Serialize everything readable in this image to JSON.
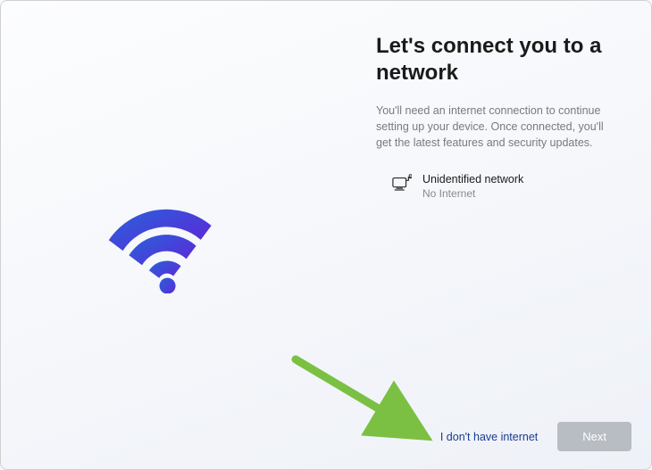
{
  "title": "Let's connect you to a network",
  "subtitle": "You'll need an internet connection to continue setting up your device. Once connected, you'll get the latest features and security updates.",
  "network": {
    "name": "Unidentified network",
    "status": "No Internet"
  },
  "actions": {
    "no_internet_label": "I don't have internet",
    "next_label": "Next"
  },
  "colors": {
    "wifi_gradient_start": "#2b5fd9",
    "wifi_gradient_end": "#5a2bd9",
    "link_color": "#1a3c8c",
    "arrow_color": "#7bc043"
  }
}
